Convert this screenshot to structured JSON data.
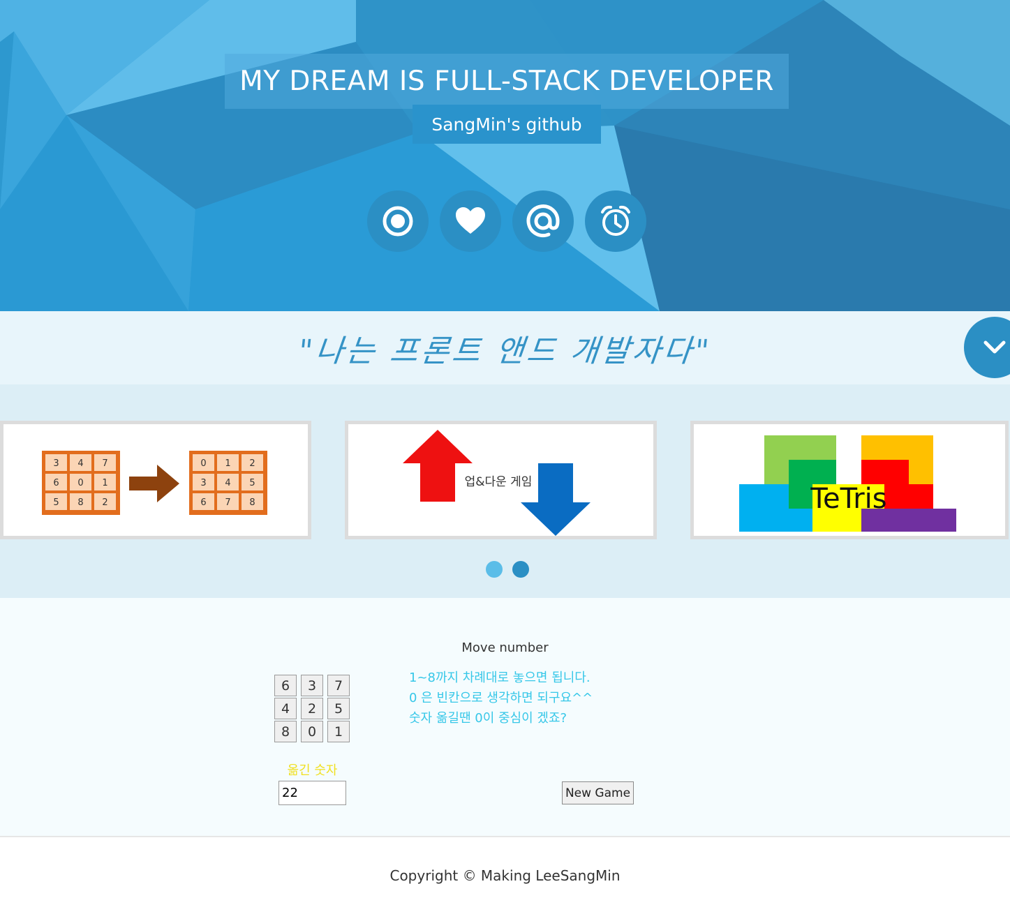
{
  "hero": {
    "title": "MY DREAM IS FULL-STACK DEVELOPER",
    "github_label": "SangMin's github",
    "icons": [
      "circle-icon",
      "heart-icon",
      "at-icon",
      "alarm-clock-icon"
    ]
  },
  "quote": {
    "text": "\"나는 프론트 앤드 개발자다\""
  },
  "carousel": {
    "slides": [
      {
        "name": "puzzle",
        "grid_before": [
          "3",
          "4",
          "7",
          "6",
          "0",
          "1",
          "5",
          "8",
          "2"
        ],
        "grid_after": [
          "0",
          "1",
          "2",
          "3",
          "4",
          "5",
          "6",
          "7",
          "8"
        ]
      },
      {
        "name": "updown",
        "label": "업&다운 게임"
      },
      {
        "name": "tetris",
        "label": "TeTris"
      }
    ],
    "active_dot": 1,
    "colors": {
      "dot_inactive": "#5bbde8",
      "dot_active": "#2b8fc4"
    }
  },
  "game": {
    "title": "Move number",
    "cells": [
      "6",
      "3",
      "7",
      "4",
      "2",
      "5",
      "8",
      "0",
      "1"
    ],
    "instructions": [
      "1~8까지 차례대로 놓으면 됩니다.",
      "0 은 빈칸으로 생각하면 되구요^^",
      "숫자 옮길땐 0이 중심이 겠죠?"
    ],
    "moved_label": "옮긴 숫자",
    "moved_value": "22",
    "new_game_label": "New Game"
  },
  "footer": {
    "text": "Copyright © Making LeeSangMin"
  },
  "colors": {
    "accent": "#2b8fc4",
    "instruction_text": "#36c7e8",
    "moved_label": "#f0e020"
  }
}
